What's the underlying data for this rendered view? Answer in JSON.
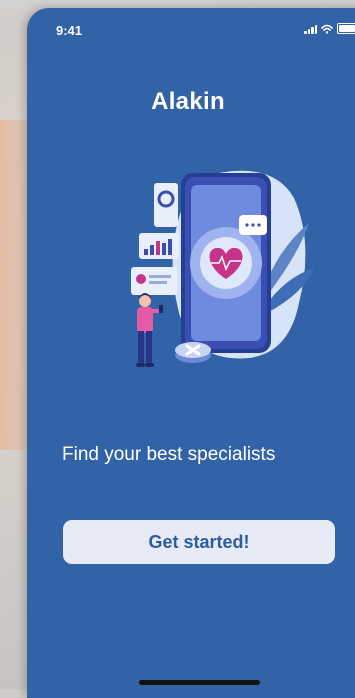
{
  "status_bar": {
    "time": "9:41"
  },
  "app": {
    "title": "Alakin"
  },
  "onboarding": {
    "tagline": "Find your best specialists",
    "cta_label": "Get started!"
  },
  "icons": [
    "signal-icon",
    "wifi-icon",
    "battery-icon",
    "heart-icon",
    "close-icon"
  ],
  "colors": {
    "primary": "#3163a6",
    "button_bg": "#e6ebf6",
    "button_text": "#2e5d9f",
    "text": "#ffffff"
  }
}
